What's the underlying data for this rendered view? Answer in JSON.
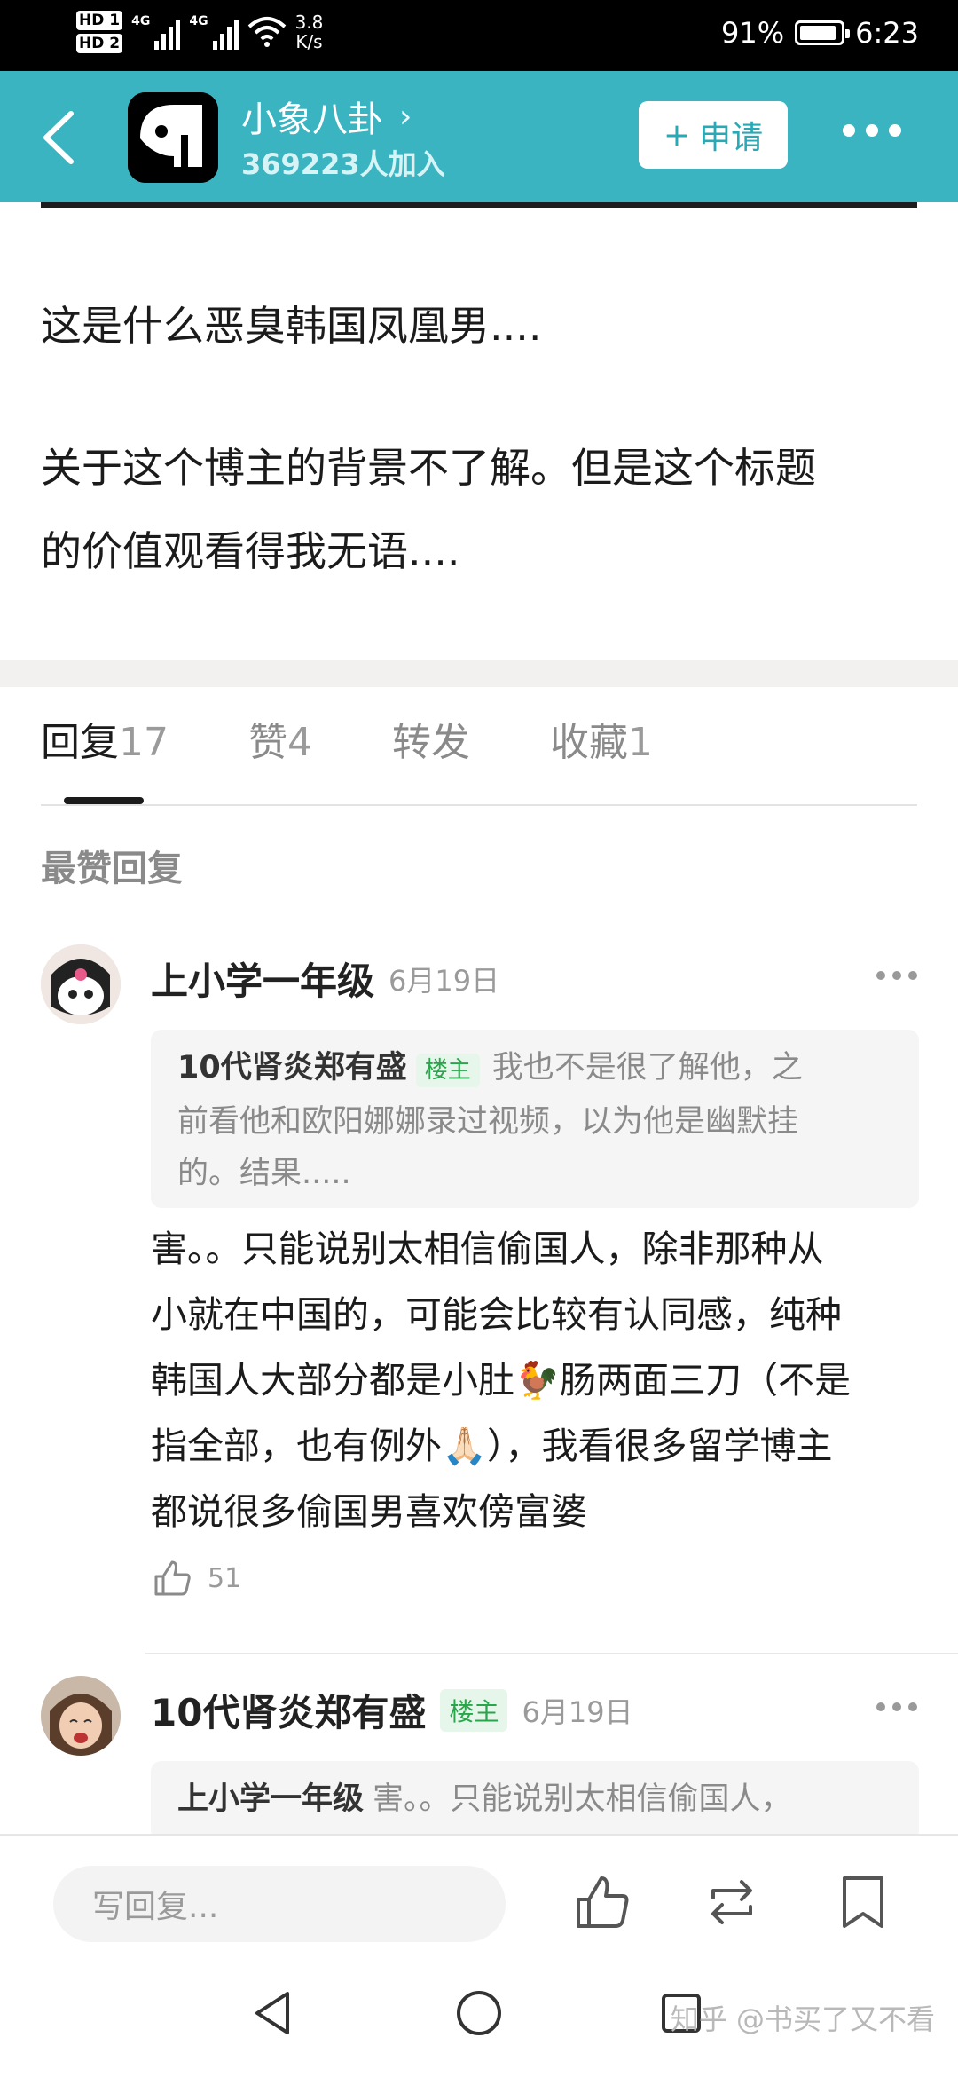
{
  "status_bar": {
    "hd1": "HD 1",
    "hd2": "HD 2",
    "net1": "4G",
    "net2": "4G",
    "speed_value": "3.8",
    "speed_unit": "K/s",
    "battery_percent": "91%",
    "battery_level": 0.91,
    "time": "6:23"
  },
  "header": {
    "group_name": "小象八卦",
    "members": "369223人加入",
    "apply_label": "申请",
    "apply_plus": "+"
  },
  "post": {
    "paragraphs": [
      "这是什么恶臭韩国凤凰男....",
      "关于这个博主的背景不了解。但是这个标题",
      "的价值观看得我无语...."
    ]
  },
  "tabs": [
    {
      "label": "回复",
      "count": "17"
    },
    {
      "label": "赞",
      "count": "4"
    },
    {
      "label": "转发",
      "count": ""
    },
    {
      "label": "收藏",
      "count": "1"
    }
  ],
  "section_title": "最赞回复",
  "comments": [
    {
      "author": "上小学一年级",
      "date": "6月19日",
      "quote_author": "10代肾炎郑有盛",
      "quote_badge": "楼主",
      "quote_lines": [
        "我也不是很了解他，之",
        "前看他和欧阳娜娜录过视频，以为他是幽默挂",
        "的。结果....."
      ],
      "text_lines": [
        "害。。只能说别太相信偷国人，除非那种从",
        "小就在中国的，可能会比较有认同感，纯种",
        "韩国人大部分都是小肚🐓肠两面三刀（不是",
        "指全部，也有例外🙏🏻），我看很多留学博主",
        "都说很多偷国男喜欢傍富婆"
      ],
      "likes": "51"
    },
    {
      "author": "10代肾炎郑有盛",
      "badge": "楼主",
      "date": "6月19日",
      "quote_author": "上小学一年级",
      "quote_text": "害。。只能说别太相信偷国人，"
    }
  ],
  "bottom_bar": {
    "reply_placeholder": "写回复..."
  },
  "watermark": "知乎 @书买了又不看",
  "colors": {
    "header_bg": "#3ab4c0",
    "accent": "#27a9b6",
    "badge_green": "#2aa54b"
  },
  "icons": [
    "back-arrow-icon",
    "chevron-right-icon",
    "more-icon",
    "thumb-up-icon",
    "repost-icon",
    "bookmark-icon",
    "nav-back-icon",
    "nav-home-icon",
    "nav-recent-icon"
  ]
}
